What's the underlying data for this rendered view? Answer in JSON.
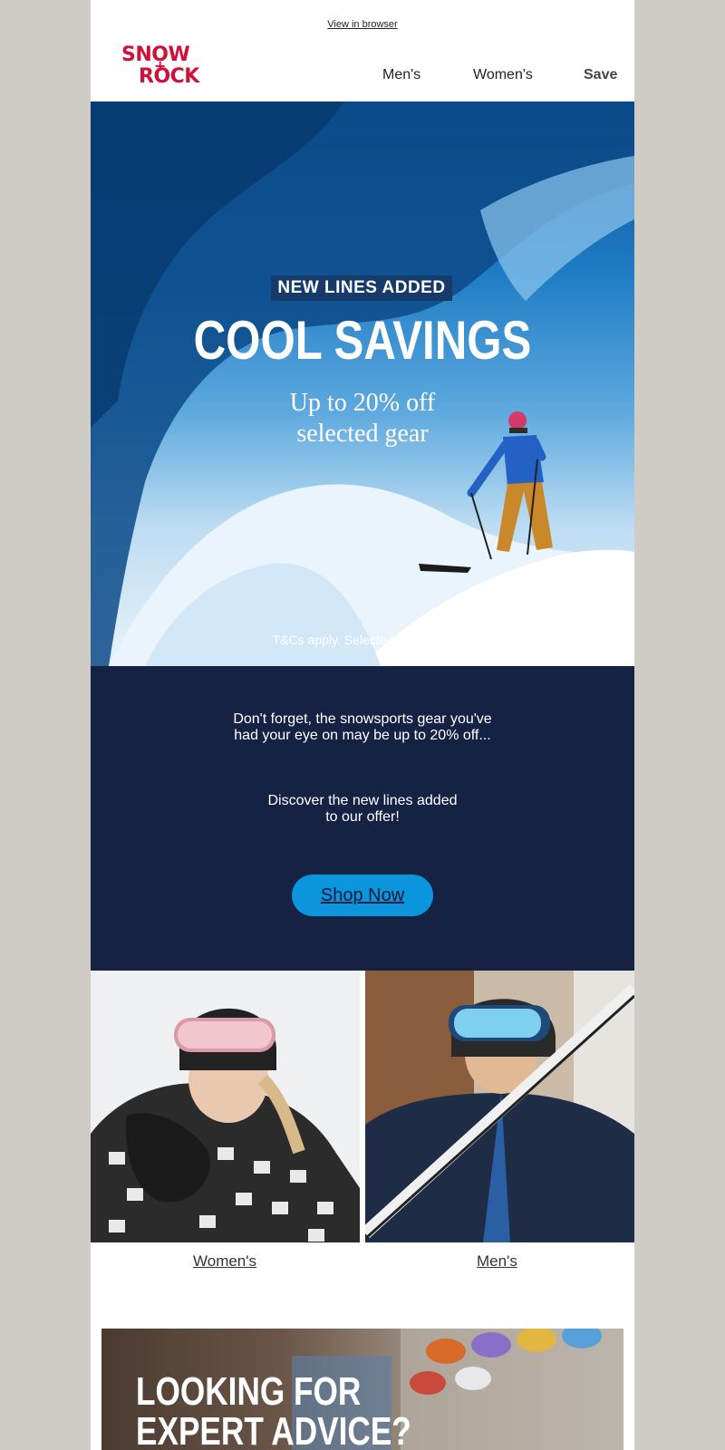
{
  "header": {
    "view_in_browser": "View in browser",
    "logo_line1": "SNOW",
    "logo_plus": "+",
    "logo_line2": "ROCK",
    "nav": {
      "mens": "Men's",
      "womens": "Women's",
      "save": "Save"
    }
  },
  "hero": {
    "badge": "NEW LINES ADDED",
    "headline": "COOL SAVINGS",
    "sub_line1": "Up to 20% off",
    "sub_line2": "selected gear",
    "terms": "T&Cs apply. Selected lines only."
  },
  "promo": {
    "line1": "Don't forget, the snowsports gear you've",
    "line2": "had your eye on may be up to 20% off...",
    "line3": "Discover the new lines added",
    "line4": "to our offer!",
    "button": "Shop Now"
  },
  "tiles": {
    "womens_label": "Women's",
    "mens_label": "Men's"
  },
  "advice": {
    "title_line1": "LOOKING FOR",
    "title_line2": "EXPERT ADVICE?"
  },
  "colors": {
    "page_bg": "#cfcbc5",
    "brand_red": "#d0103a",
    "navy": "#162244",
    "button_blue": "#0b95dc"
  }
}
